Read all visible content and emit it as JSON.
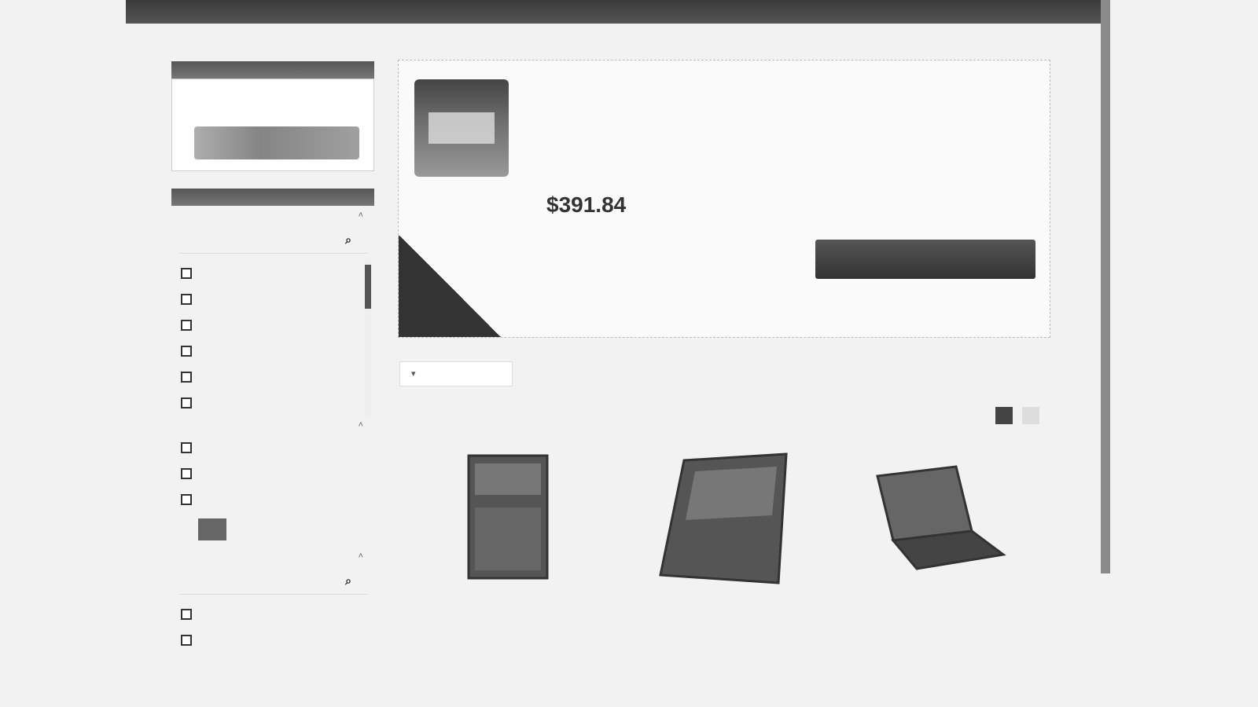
{
  "featured": {
    "price": "$391.84"
  }
}
